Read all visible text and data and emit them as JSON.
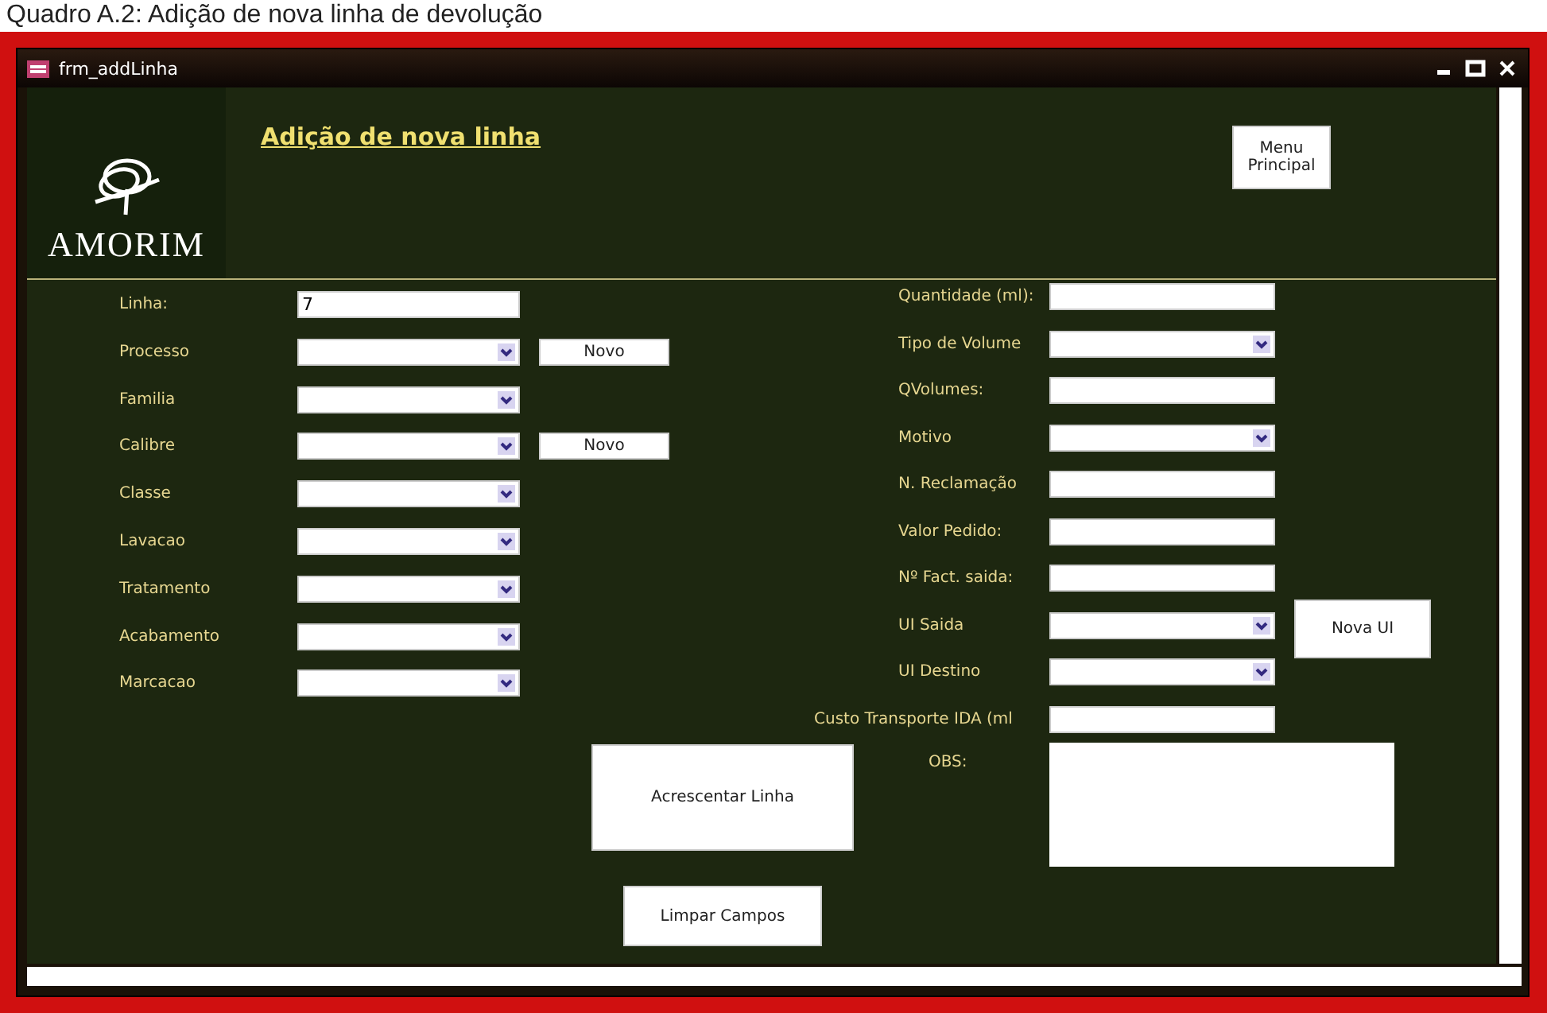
{
  "caption": "Quadro A.2: Adição de nova linha de devolução",
  "window": {
    "title": "frm_addLinha"
  },
  "header": {
    "logo_text": "AMORIM",
    "title": "Adição de nova linha",
    "menu_button": "Menu Principal"
  },
  "left_fields": [
    {
      "label": "Linha:",
      "kind": "text",
      "value": "7"
    },
    {
      "label": "Processo",
      "kind": "select",
      "button": "Novo"
    },
    {
      "label": "Familia",
      "kind": "select"
    },
    {
      "label": "Calibre",
      "kind": "select",
      "button": "Novo"
    },
    {
      "label": "Classe",
      "kind": "select"
    },
    {
      "label": "Lavacao",
      "kind": "select"
    },
    {
      "label": "Tratamento",
      "kind": "select"
    },
    {
      "label": "Acabamento",
      "kind": "select"
    },
    {
      "label": "Marcacao",
      "kind": "select"
    }
  ],
  "right_fields": [
    {
      "label": "Quantidade (ml):",
      "kind": "text"
    },
    {
      "label": "Tipo de Volume",
      "kind": "select"
    },
    {
      "label": "QVolumes:",
      "kind": "text"
    },
    {
      "label": "Motivo",
      "kind": "select"
    },
    {
      "label": "N. Reclamação",
      "kind": "text"
    },
    {
      "label": "Valor Pedido:",
      "kind": "text"
    },
    {
      "label": "Nº Fact. saida:",
      "kind": "text"
    },
    {
      "label": "UI Saida",
      "kind": "select",
      "button": "Nova UI"
    },
    {
      "label": "UI Destino",
      "kind": "select"
    },
    {
      "label": "Custo Transporte IDA (ml",
      "kind": "text"
    },
    {
      "label": "OBS:",
      "kind": "memo"
    }
  ],
  "actions": [
    "Acrescentar Linha",
    "Limpar Campos"
  ]
}
